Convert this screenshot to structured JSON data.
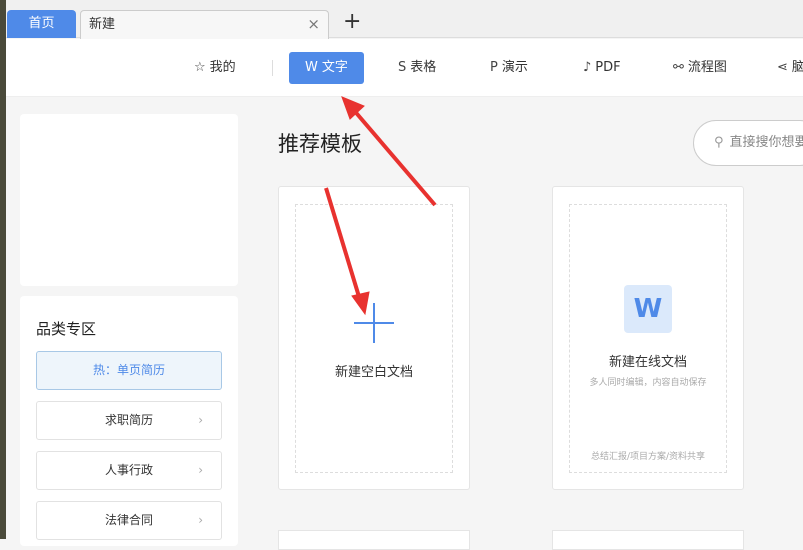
{
  "tabs": {
    "home": "首页",
    "new": "新建",
    "close": "×",
    "add": "+"
  },
  "nav": [
    {
      "icon": "☆",
      "label": "我的"
    },
    {
      "icon": "W",
      "label": "文字"
    },
    {
      "icon": "S",
      "label": "表格"
    },
    {
      "icon": "P",
      "label": "演示"
    },
    {
      "icon": "♪",
      "label": "PDF"
    },
    {
      "icon": "⚯",
      "label": "流程图"
    },
    {
      "icon": "⋖",
      "label": "脑图"
    }
  ],
  "sidebar": {
    "title": "品类专区",
    "items": [
      {
        "label": "热：单页简历"
      },
      {
        "label": "求职简历"
      },
      {
        "label": "人事行政"
      },
      {
        "label": "法律合同"
      }
    ],
    "chev": "›"
  },
  "main": {
    "title": "推荐模板",
    "search_placeholder": "直接搜你想要的",
    "cards": [
      {
        "label": "新建空白文档"
      },
      {
        "label": "新建在线文档",
        "desc": "多人同时编辑，内容自动保存",
        "tags": "总结汇报/项目方案/资料共享",
        "icon": "W"
      }
    ]
  },
  "accent": "#4f8ae8"
}
